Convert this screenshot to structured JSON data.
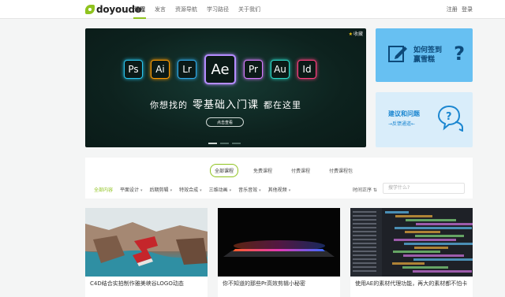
{
  "site": {
    "logo": "doyoudo"
  },
  "nav": {
    "items": [
      "课程",
      "发言",
      "资源导航",
      "学习路径",
      "关于我们"
    ],
    "active_index": 0
  },
  "auth": {
    "register": "注册",
    "login": "登录"
  },
  "banner": {
    "favorite": "收藏",
    "apps": [
      "Ps",
      "Ai",
      "Lr",
      "Ae",
      "Pr",
      "Au",
      "Id"
    ],
    "tagline_left": "你想找的",
    "tagline_highlight": "零基础入门课",
    "tagline_right": "都在这里",
    "cta": "点击查看",
    "slide_count": 3,
    "active_slide": 0
  },
  "side_cards": {
    "checkin": {
      "title": "如何签到赢雪糕",
      "mark": "?"
    },
    "feedback": {
      "title": "建议和问题",
      "sub": "→反馈通道←"
    }
  },
  "filter": {
    "tabs": [
      "全部课程",
      "免费课程",
      "付费课程",
      "付费课程包"
    ],
    "active_tab": 0,
    "categories": [
      {
        "label": "全部内容",
        "active": true,
        "dropdown": false
      },
      {
        "label": "平面设计",
        "active": false,
        "dropdown": true
      },
      {
        "label": "后期剪辑",
        "active": false,
        "dropdown": true
      },
      {
        "label": "特效合成",
        "active": false,
        "dropdown": true
      },
      {
        "label": "三维动画",
        "active": false,
        "dropdown": true
      },
      {
        "label": "音乐音效",
        "active": false,
        "dropdown": true
      },
      {
        "label": "其他视频",
        "active": false,
        "dropdown": true
      }
    ],
    "sort_label": "时间正序 ⇅",
    "search_placeholder": "搜学什么?"
  },
  "courses": [
    {
      "title": "C4D结合实拍制作雅美峡谷LOGO动态"
    },
    {
      "title": "你不知道的那些Pr高效剪辑小秘密"
    },
    {
      "title": "使用AE的素材代理功能，再大的素材都不怕卡"
    }
  ],
  "colors": {
    "accent": "#8fc31f",
    "banner_bg": "#0d221e",
    "card_checkin": "#67c0f2",
    "card_feedback": "#d9edfa",
    "app_colors": [
      "#29c6f0",
      "#ff9a00",
      "#2fa9e8",
      "#b58cff",
      "#d77bff",
      "#2cd8c8",
      "#ff3e7e"
    ]
  }
}
